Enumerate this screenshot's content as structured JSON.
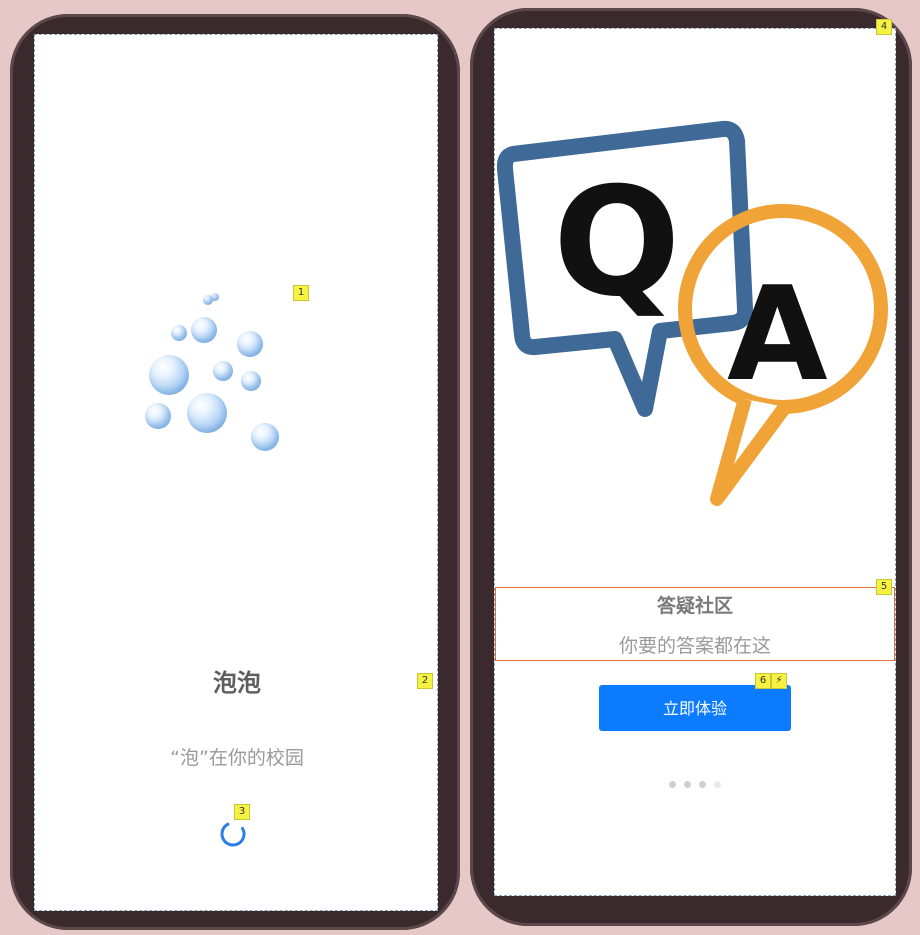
{
  "splash": {
    "title": "泡泡",
    "slogan": "“泡”在你的校园",
    "logo_icon": "bubbles-icon",
    "loading_icon": "spinner-icon",
    "accent": "#2a7ee6"
  },
  "onboarding": {
    "illustration_icon": "qa-chat-bubbles-icon",
    "illustration_text_q": "Q",
    "illustration_text_a": "A",
    "title": "答疑社区",
    "subtitle": "你要的答案都在这",
    "cta_label": "立即体验",
    "cta_color": "#0b7bff",
    "page_indicator": {
      "total": 4
    }
  },
  "annotations": {
    "m1": "1",
    "m2": "2",
    "m3": "3",
    "m4": "4",
    "m5": "5",
    "m6": "6",
    "m6_icon": "lightning-icon"
  }
}
